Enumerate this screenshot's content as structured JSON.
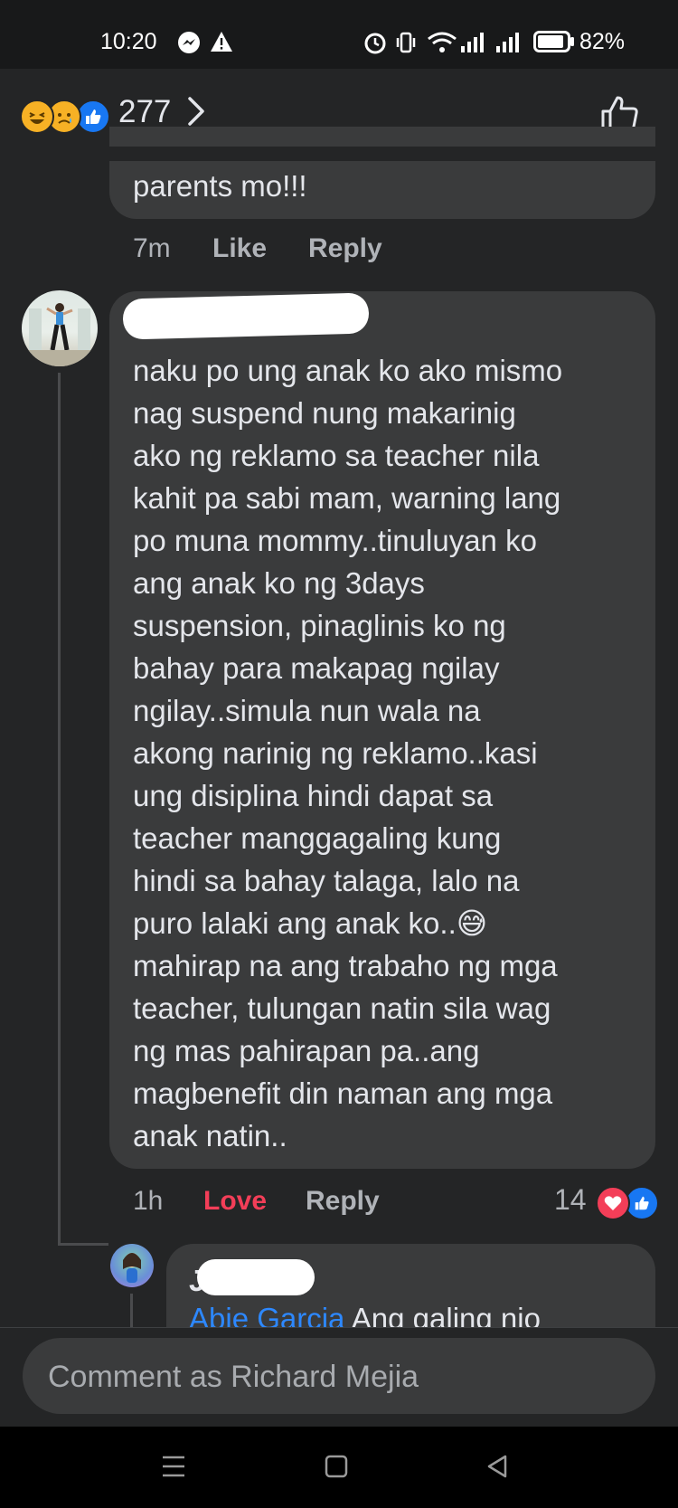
{
  "status_bar": {
    "time": "10:20",
    "battery_percent": "82%",
    "battery_level": 0.82
  },
  "reactions_header": {
    "count": "277",
    "emojis": [
      "laughing-emoji",
      "sad-emoji",
      "like-emoji"
    ]
  },
  "comments": [
    {
      "id": "prev",
      "text": "parents mo!!!",
      "time": "7m",
      "like_label": "Like",
      "reply_label": "Reply"
    },
    {
      "id": "main",
      "text": "naku po ung anak ko ako mismo nag suspend nung makarinig ako ng reklamo sa teacher nila kahit pa sabi mam, warning lang po muna mommy..tinuluyan ko ang anak ko ng 3days suspension, pinaglinis ko ng bahay para makapag ngilay ngilay..simula nun wala na akong narinig ng reklamo..kasi ung disiplina hindi dapat sa teacher manggagaling kung hindi sa bahay talaga, lalo na puro lalaki ang anak ko..😅 mahirap na ang trabaho ng mga teacher, tulungan natin sila wag ng mas pahirapan pa..ang magbenefit din naman ang mga anak natin..",
      "lines": [
        "naku po ung anak ko ako mismo",
        "nag suspend nung makarinig",
        "ako ng reklamo sa teacher nila",
        "kahit pa sabi mam, warning lang",
        "po muna mommy..tinuluyan ko",
        "ang anak ko ng 3days",
        "suspension, pinaglinis ko ng",
        "bahay para makapag ngilay",
        "ngilay..simula nun wala na",
        "akong narinig ng reklamo..kasi",
        "ung disiplina hindi dapat sa",
        "teacher manggagaling kung",
        "hindi sa bahay talaga, lalo na",
        "puro lalaki ang anak ko..😅",
        "mahirap na ang trabaho ng mga",
        "teacher, tulungan natin sila wag",
        "ng mas pahirapan pa..ang",
        "magbenefit din naman ang mga",
        "anak natin.."
      ],
      "time": "1h",
      "love_label": "Love",
      "reply_label": "Reply",
      "reaction_count": "14"
    },
    {
      "id": "reply",
      "initial": "J",
      "mention": "Abie Garcia",
      "text": "Ang galing nio"
    }
  ],
  "comment_input": {
    "placeholder": "Comment as Richard Mejia"
  },
  "colors": {
    "background": "#242526",
    "bubble": "#3a3b3c",
    "love_red": "#f33e58",
    "like_blue": "#1877f2",
    "mention_blue": "#2d88ff"
  }
}
